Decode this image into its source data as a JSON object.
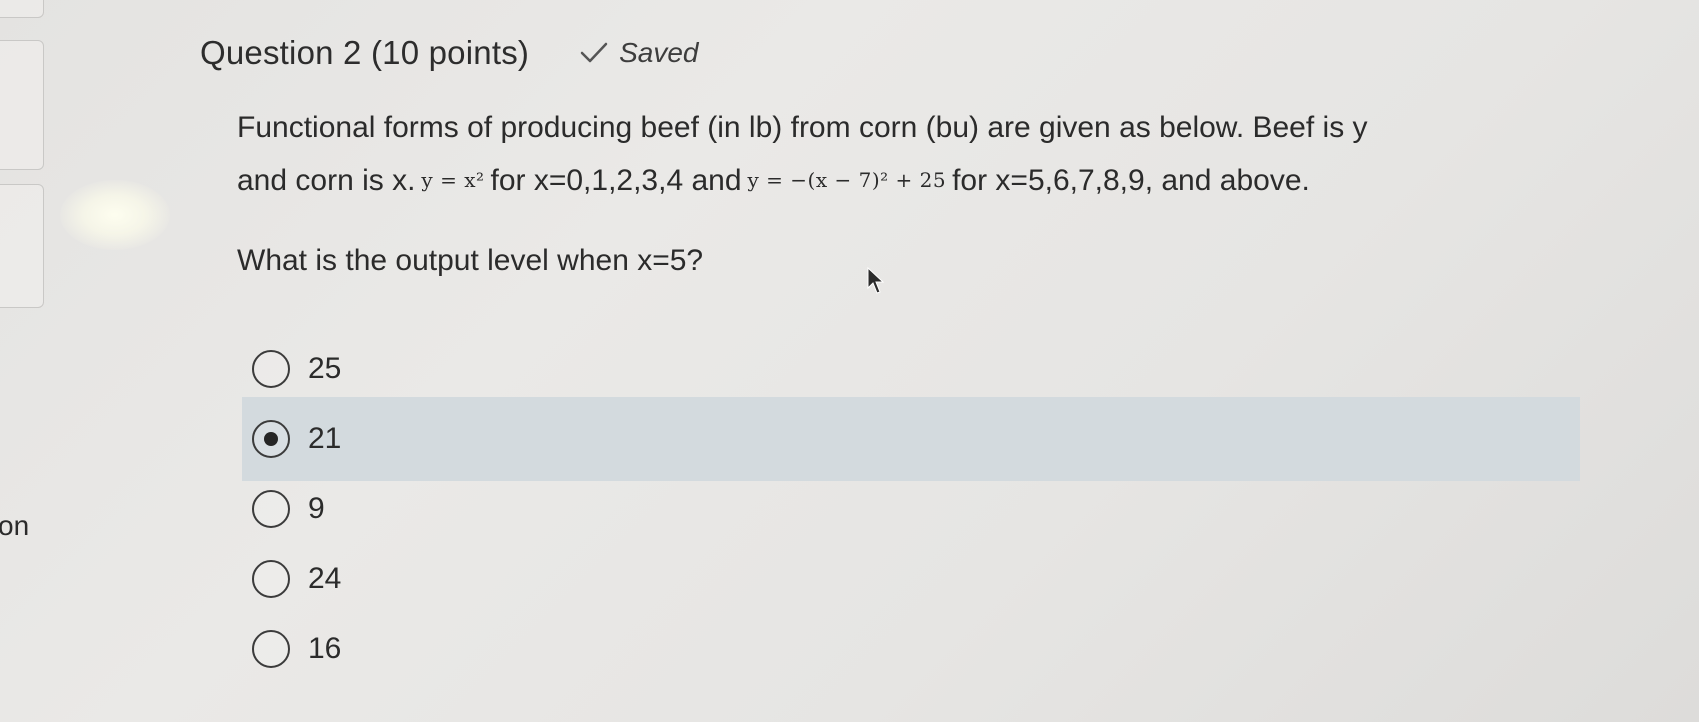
{
  "sidebar": {
    "partial_label": "on"
  },
  "question": {
    "title": "Question 2 (10 points)",
    "status": "Saved",
    "body_line1": "Functional forms of producing beef (in lb) from corn (bu) are given as below. Beef is y",
    "body_line2_a": "and corn is x.",
    "formula_1": "y = x²",
    "body_line2_b": "for x=0,1,2,3,4 and",
    "formula_2": "y = −(x − 7)² + 25",
    "body_line2_c": "for x=5,6,7,8,9, and above.",
    "prompt": "What is the output level when x=5?"
  },
  "options": [
    {
      "label": "25",
      "selected": false
    },
    {
      "label": "21",
      "selected": true
    },
    {
      "label": "9",
      "selected": false
    },
    {
      "label": "24",
      "selected": false
    },
    {
      "label": "16",
      "selected": false
    }
  ],
  "colors": {
    "selected_row": "#d3dade",
    "background": "#e6e5e3"
  }
}
